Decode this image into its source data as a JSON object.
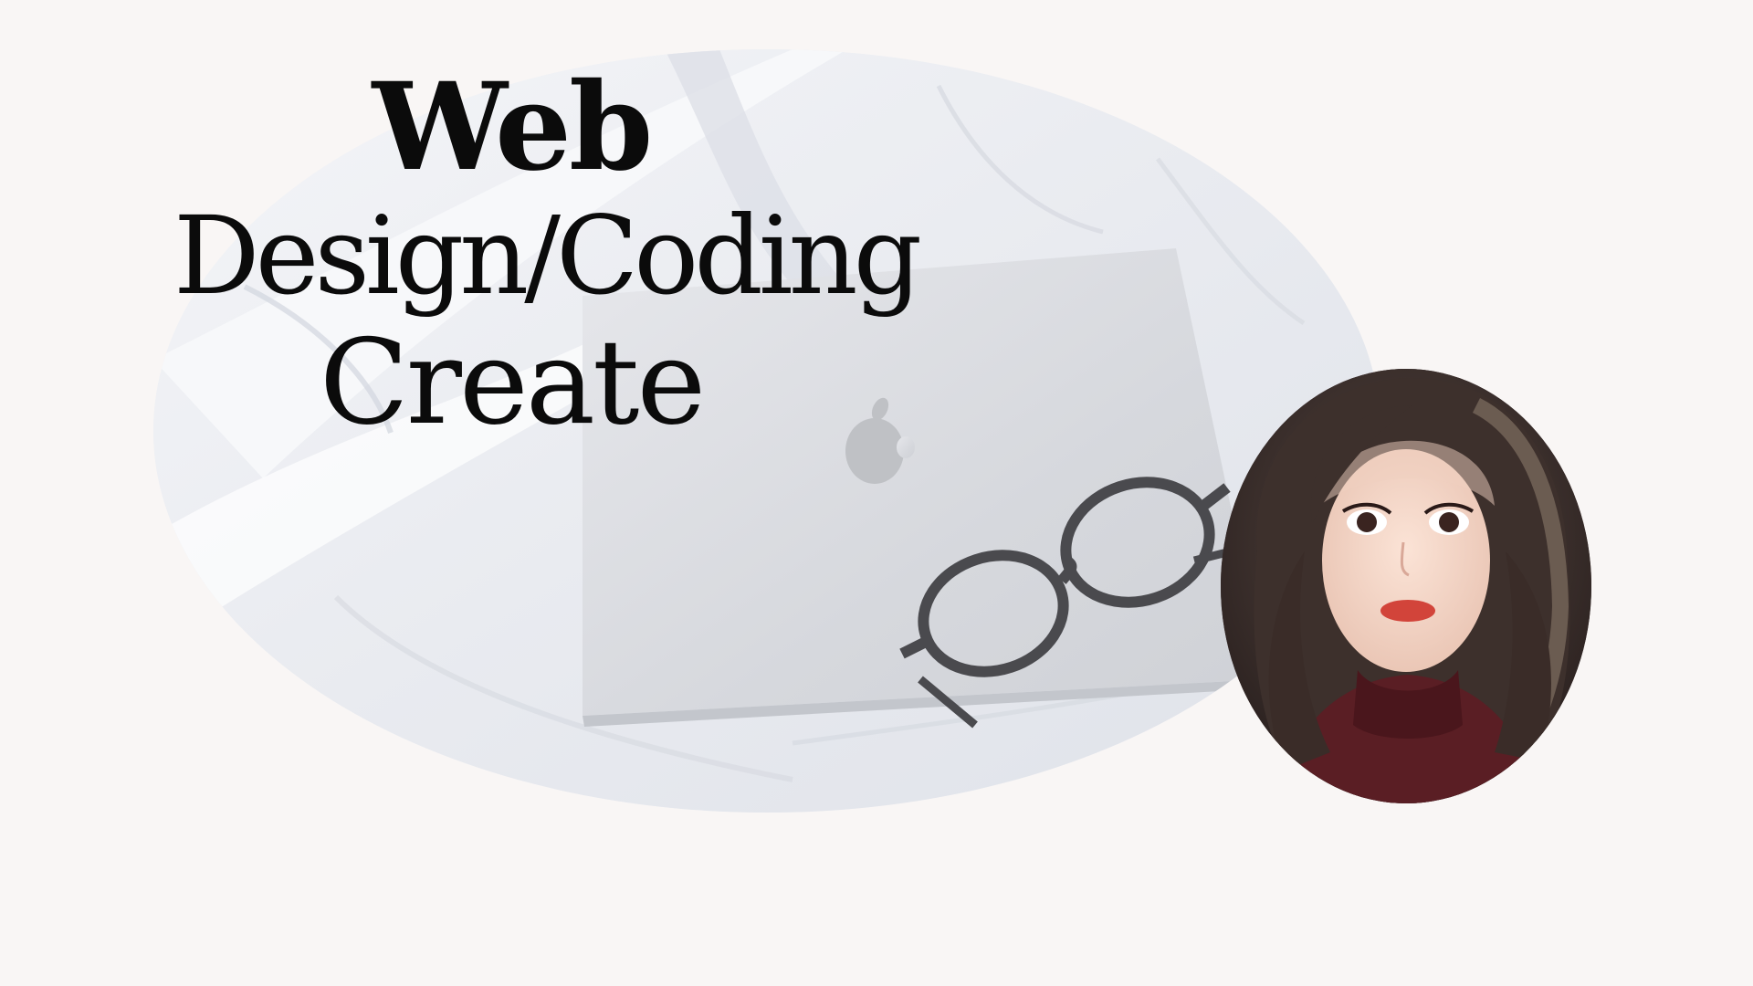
{
  "page": {
    "background_color": "#f9f6f5"
  },
  "title": {
    "line1": "Web",
    "line2": "Design/Coding",
    "line3": "Create"
  },
  "hero_image": {
    "shape": "oval",
    "subject_icon": "apple-logo-icon"
  },
  "portrait_image": {
    "shape": "oval"
  },
  "colors": {
    "title_text": "#0b0b0b",
    "sheet": "#eef0f5",
    "laptop": "#d9dbe0",
    "glasses": "#4a4a4e"
  }
}
